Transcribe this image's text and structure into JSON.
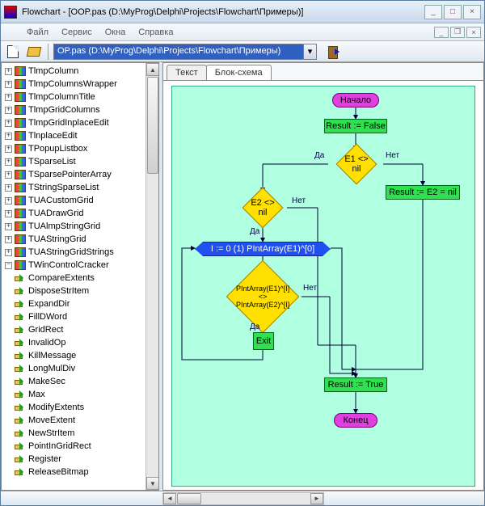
{
  "window_title": "Flowchart - [OOP.pas (D:\\MyProg\\Delphi\\Projects\\Flowchart\\Примеры)]",
  "menu": {
    "file": "Файл",
    "service": "Сервис",
    "windows": "Окна",
    "help": "Справка"
  },
  "toolbar": {
    "selected_file": "OP.pas (D:\\MyProg\\Delphi\\Projects\\Flowchart\\Примеры)"
  },
  "tree_items": [
    {
      "label": "TlmpColumn",
      "kind": "class",
      "pm": "plus"
    },
    {
      "label": "TlmpColumnsWrapper",
      "kind": "class",
      "pm": "plus"
    },
    {
      "label": "TlmpColumnTitle",
      "kind": "class",
      "pm": "plus"
    },
    {
      "label": "TlmpGridColumns",
      "kind": "class",
      "pm": "plus"
    },
    {
      "label": "TlmpGridInplaceEdit",
      "kind": "class",
      "pm": "plus"
    },
    {
      "label": "TlnplaceEdit",
      "kind": "class",
      "pm": "plus"
    },
    {
      "label": "TPopupListbox",
      "kind": "class",
      "pm": "plus"
    },
    {
      "label": "TSparseList",
      "kind": "class",
      "pm": "plus"
    },
    {
      "label": "TSparsePointerArray",
      "kind": "class",
      "pm": "plus"
    },
    {
      "label": "TStringSparseList",
      "kind": "class",
      "pm": "plus"
    },
    {
      "label": "TUACustomGrid",
      "kind": "class",
      "pm": "plus"
    },
    {
      "label": "TUADrawGrid",
      "kind": "class",
      "pm": "plus"
    },
    {
      "label": "TUAlmpStringGrid",
      "kind": "class",
      "pm": "plus"
    },
    {
      "label": "TUAStringGrid",
      "kind": "class",
      "pm": "plus"
    },
    {
      "label": "TUAStringGridStrings",
      "kind": "class",
      "pm": "plus"
    },
    {
      "label": "TWinControlCracker",
      "kind": "class",
      "pm": "minus"
    },
    {
      "label": "CompareExtents",
      "kind": "func",
      "pm": "none"
    },
    {
      "label": "DisposeStrItem",
      "kind": "func",
      "pm": "none"
    },
    {
      "label": "ExpandDir",
      "kind": "func",
      "pm": "none"
    },
    {
      "label": "FillDWord",
      "kind": "func",
      "pm": "none"
    },
    {
      "label": "GridRect",
      "kind": "func",
      "pm": "none"
    },
    {
      "label": "InvalidOp",
      "kind": "func",
      "pm": "none"
    },
    {
      "label": "KillMessage",
      "kind": "func",
      "pm": "none"
    },
    {
      "label": "LongMulDiv",
      "kind": "func",
      "pm": "none"
    },
    {
      "label": "MakeSec",
      "kind": "func",
      "pm": "none"
    },
    {
      "label": "Max",
      "kind": "func",
      "pm": "none"
    },
    {
      "label": "ModifyExtents",
      "kind": "func",
      "pm": "none"
    },
    {
      "label": "MoveExtent",
      "kind": "func",
      "pm": "none"
    },
    {
      "label": "NewStrItem",
      "kind": "func",
      "pm": "none"
    },
    {
      "label": "PointInGridRect",
      "kind": "func",
      "pm": "none"
    },
    {
      "label": "Register",
      "kind": "func",
      "pm": "none"
    },
    {
      "label": "ReleaseBitmap",
      "kind": "func",
      "pm": "none"
    }
  ],
  "tabs": {
    "text": "Текст",
    "flowchart": "Блок-схема"
  },
  "flow": {
    "start": "Начало",
    "result_false": "Result := False",
    "e1_nil": "E1 <> nil",
    "yes": "Да",
    "no": "Нет",
    "e2_nil": "E2 <> nil",
    "result_e2nil": "Result := E2 = nil",
    "loop": "I := 0 (1) PIntArray(E1)^[0]",
    "compare": "PIntArray(E1)^[I] <> PIntArray(E2)^[I]",
    "exit": "Exit",
    "result_true": "Result := True",
    "end": "Конец"
  }
}
